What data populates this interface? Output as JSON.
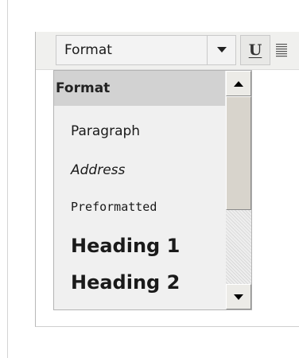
{
  "toolbar": {
    "format_select": {
      "value": "Format",
      "dropdown_icon": "chevron-down-icon"
    },
    "underline_button": {
      "label": "U",
      "icon": "underline-icon"
    },
    "justify_button": {
      "icon": "align-justify-icon"
    }
  },
  "format_dropdown": {
    "header": "Format",
    "options": [
      {
        "label": "Paragraph",
        "style": "normal"
      },
      {
        "label": "Address",
        "style": "italic"
      },
      {
        "label": "Preformatted",
        "style": "monospace"
      },
      {
        "label": "Heading 1",
        "style": "h1"
      },
      {
        "label": "Heading 2",
        "style": "h2"
      }
    ],
    "scrollbar": {
      "up_icon": "arrow-up-icon",
      "down_icon": "arrow-down-icon"
    }
  }
}
